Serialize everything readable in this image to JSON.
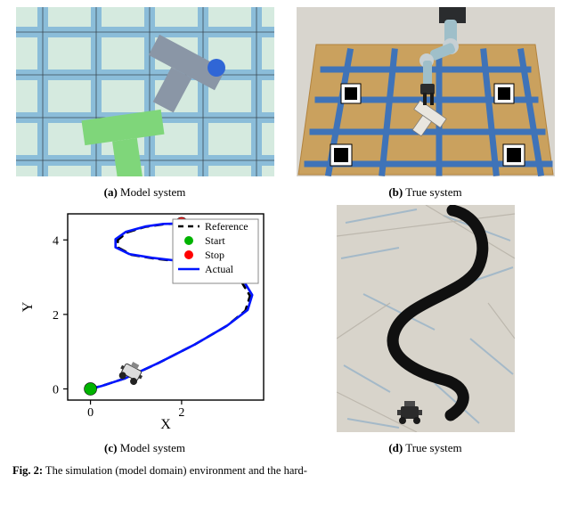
{
  "sub_a": {
    "tag": "(a)",
    "text": " Model system"
  },
  "sub_b": {
    "tag": "(b)",
    "text": " True system"
  },
  "sub_c": {
    "tag": "(c)",
    "text": " Model system"
  },
  "sub_d": {
    "tag": "(d)",
    "text": " True system"
  },
  "caption": {
    "tag": "Fig. 2:",
    "text": " The simulation (model domain) environment and the hard-"
  },
  "chart_data": {
    "type": "line",
    "title": "",
    "xlabel": "X",
    "ylabel": "Y",
    "xlim": [
      -0.5,
      3.8
    ],
    "ylim": [
      -0.3,
      4.7
    ],
    "x_ticks": [
      0,
      2
    ],
    "y_ticks": [
      0,
      2,
      4
    ],
    "legend_position": "upper-right",
    "series": [
      {
        "name": "Reference",
        "style": "dashed",
        "color": "#000000",
        "x": [
          0.0,
          0.3,
          0.8,
          1.5,
          2.3,
          3.0,
          3.4,
          3.5,
          3.3,
          2.8,
          2.1,
          1.4,
          0.9,
          0.6,
          0.6,
          0.8,
          1.2,
          1.6,
          1.9,
          2.0
        ],
        "y": [
          0.0,
          0.1,
          0.3,
          0.7,
          1.2,
          1.7,
          2.1,
          2.5,
          2.9,
          3.2,
          3.4,
          3.5,
          3.6,
          3.8,
          4.0,
          4.2,
          4.35,
          4.42,
          4.44,
          4.44
        ]
      },
      {
        "name": "Actual",
        "style": "solid",
        "color": "#0015ff",
        "x": [
          0.0,
          0.25,
          0.75,
          1.5,
          2.3,
          3.0,
          3.45,
          3.55,
          3.35,
          2.8,
          2.05,
          1.35,
          0.85,
          0.55,
          0.55,
          0.78,
          1.2,
          1.6,
          1.92,
          2.0
        ],
        "y": [
          0.0,
          0.08,
          0.28,
          0.7,
          1.2,
          1.7,
          2.12,
          2.52,
          2.92,
          3.22,
          3.42,
          3.52,
          3.62,
          3.8,
          4.02,
          4.22,
          4.36,
          4.43,
          4.44,
          4.44
        ]
      }
    ],
    "points": [
      {
        "name": "Start",
        "color": "#00b300",
        "x": 0.0,
        "y": 0.0
      },
      {
        "name": "Stop",
        "color": "#ff0000",
        "x": 2.0,
        "y": 4.44
      }
    ],
    "legend": [
      "Reference",
      "Start",
      "Stop",
      "Actual"
    ]
  }
}
